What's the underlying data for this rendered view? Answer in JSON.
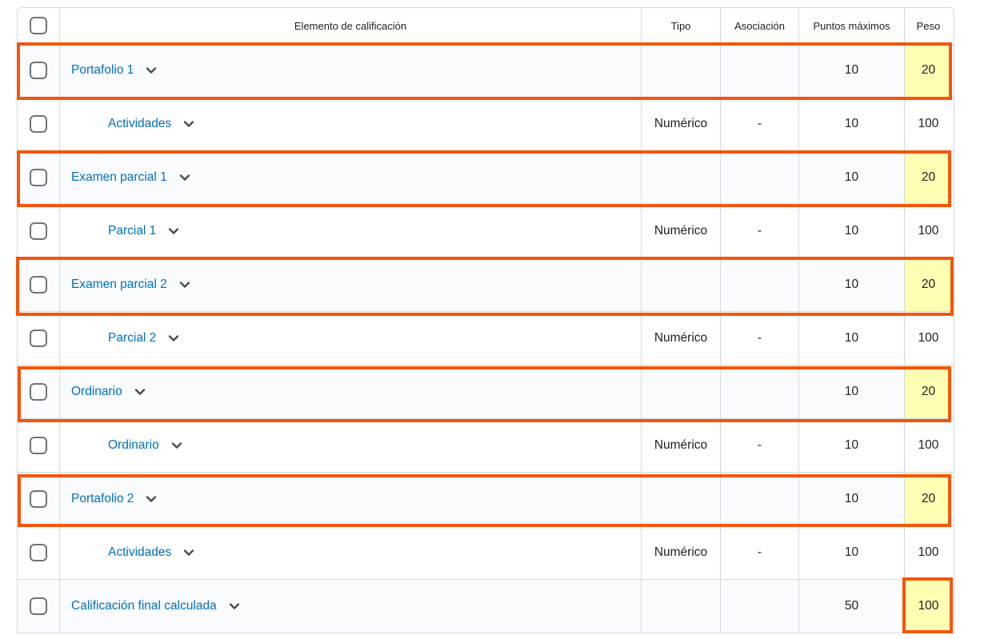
{
  "header": {
    "element_label": "Elemento de calificación",
    "tipo_label": "Tipo",
    "asociacion_label": "Asociación",
    "puntos_label": "Puntos máximos",
    "peso_label": "Peso"
  },
  "rows": [
    {
      "kind": "cat",
      "name": "Portafolio 1",
      "tipo": "",
      "asoc": "",
      "puntos": "10",
      "peso": "20"
    },
    {
      "kind": "item",
      "name": "Actividades",
      "tipo": "Numérico",
      "asoc": "-",
      "puntos": "10",
      "peso": "100"
    },
    {
      "kind": "cat",
      "name": "Examen parcial 1",
      "tipo": "",
      "asoc": "",
      "puntos": "10",
      "peso": "20"
    },
    {
      "kind": "item",
      "name": "Parcial 1",
      "tipo": "Numérico",
      "asoc": "-",
      "puntos": "10",
      "peso": "100"
    },
    {
      "kind": "cat",
      "name": "Examen parcial 2",
      "tipo": "",
      "asoc": "",
      "puntos": "10",
      "peso": "20"
    },
    {
      "kind": "item",
      "name": "Parcial 2",
      "tipo": "Numérico",
      "asoc": "-",
      "puntos": "10",
      "peso": "100"
    },
    {
      "kind": "cat",
      "name": "Ordinario",
      "tipo": "",
      "asoc": "",
      "puntos": "10",
      "peso": "20"
    },
    {
      "kind": "item",
      "name": "Ordinario",
      "tipo": "Numérico",
      "asoc": "-",
      "puntos": "10",
      "peso": "100"
    },
    {
      "kind": "cat",
      "name": "Portafolio 2",
      "tipo": "",
      "asoc": "",
      "puntos": "10",
      "peso": "20"
    },
    {
      "kind": "item",
      "name": "Actividades",
      "tipo": "Numérico",
      "asoc": "-",
      "puntos": "10",
      "peso": "100"
    },
    {
      "kind": "cat",
      "name": "Calificación final calculada",
      "tipo": "",
      "asoc": "",
      "puntos": "50",
      "peso": "100"
    }
  ],
  "colors": {
    "link": "#006fbf",
    "highlight_border": "#f3560d",
    "peso_highlight_fill": "#ffffb3",
    "category_row_bg": "#f9fbff"
  }
}
